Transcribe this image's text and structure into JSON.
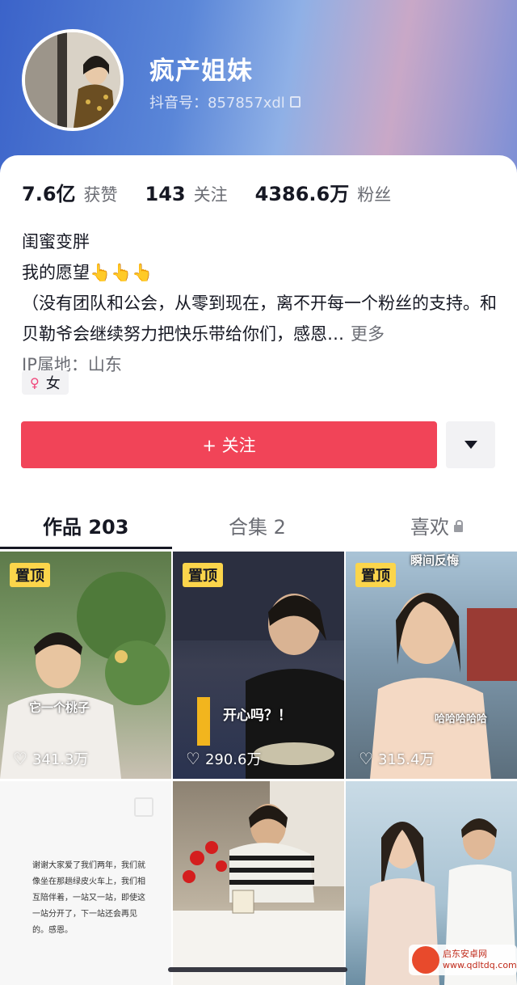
{
  "profile": {
    "name": "疯产姐妹",
    "douyin_id": "抖音号：857857xdl"
  },
  "stats": [
    {
      "value": "7.6亿",
      "label": "获赞"
    },
    {
      "value": "143",
      "label": "关注"
    },
    {
      "value": "4386.6万",
      "label": "粉丝"
    }
  ],
  "bio": {
    "line1": "闺蜜变胖",
    "line2": "我的愿望👆👆👆",
    "line3": "（没有团队和公会，从零到现在，离不开每一个粉丝的支持。和贝勒爷会继续努力把快乐带给你们，感恩…",
    "more": "更多",
    "ip": "IP属地：山东"
  },
  "gender": "女",
  "follow_button": "+ 关注",
  "tabs": [
    {
      "label": "作品 203"
    },
    {
      "label": "合集 2"
    },
    {
      "label": "喜欢"
    }
  ],
  "videos": [
    {
      "pinned": "置顶",
      "likes": "341.3万",
      "caption": "它一个桃子"
    },
    {
      "pinned": "置顶",
      "likes": "290.6万",
      "caption": "开心吗？！"
    },
    {
      "pinned": "置顶",
      "likes": "315.4万",
      "caption_top": "瞬间反悔",
      "caption": "哈哈哈哈哈"
    },
    {
      "letter": "谢谢大家爱了我们两年，我们就像坐在那趟绿皮火车上，我们相互陪伴着，一站又一站，即使这一站分开了，下一站还会再见的。感恩。"
    },
    {},
    {}
  ],
  "watermark": "启东安卓网 www.qdltdq.com",
  "colors": {
    "accent": "#f14458",
    "pin": "#fbd54b"
  }
}
